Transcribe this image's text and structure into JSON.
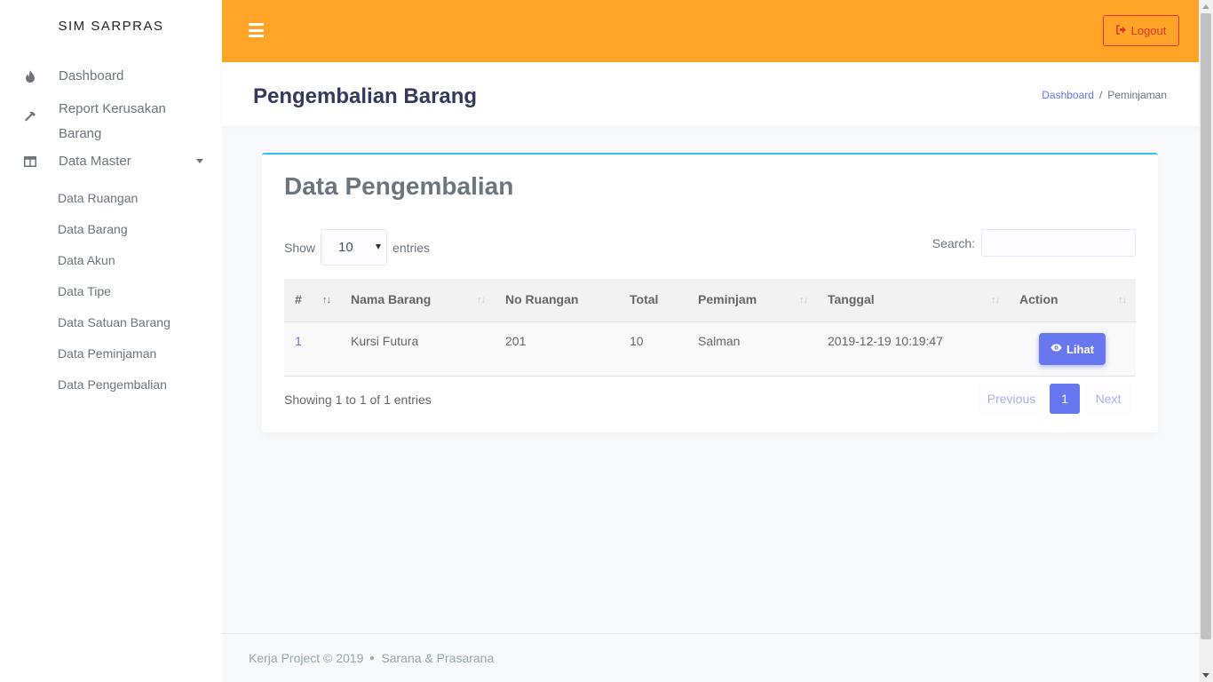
{
  "sidebar": {
    "brand": "SIM SARPRAS",
    "items": [
      {
        "label": "Dashboard",
        "icon": "fire-icon"
      },
      {
        "label": "Report Kerusakan Barang",
        "icon": "hammer-icon"
      },
      {
        "label": "Data Master",
        "icon": "columns-icon"
      }
    ],
    "submenu": [
      {
        "label": "Data Ruangan"
      },
      {
        "label": "Data Barang"
      },
      {
        "label": "Data Akun"
      },
      {
        "label": "Data Tipe"
      },
      {
        "label": "Data Satuan Barang"
      },
      {
        "label": "Data Peminjaman"
      },
      {
        "label": "Data Pengembalian"
      }
    ]
  },
  "topbar": {
    "menu_icon": "bars-icon",
    "logout_label": "Logout",
    "logout_icon": "sign-out-icon"
  },
  "header": {
    "title": "Pengembalian Barang",
    "breadcrumb": [
      "Dashboard",
      "/",
      "Peminjaman"
    ]
  },
  "card": {
    "title": "Data Pengembalian",
    "show_label": "Show",
    "length_value": "10",
    "entries_label": "entries",
    "search_label": "Search:",
    "search_value": "",
    "columns": [
      "#",
      "Nama Barang",
      "No Ruangan",
      "Total",
      "Peminjam",
      "Tanggal",
      "Action"
    ],
    "sort_glyph": "↑↓",
    "rows": [
      {
        "no": "1",
        "nama_barang": "Kursi Futura",
        "no_ruangan": "201",
        "total": "10",
        "peminjam": "Salman",
        "tanggal": "2019-12-19 10:19:47",
        "action_label": "Lihat",
        "action_icon": "eye-icon"
      }
    ],
    "info": "Showing 1 to 1 of 1 entries",
    "pagination": {
      "previous": "Previous",
      "current": "1",
      "next": "Next"
    }
  },
  "footer": {
    "left": "Kerja Project © 2019",
    "right": "Sarana & Prasarana"
  },
  "colors": {
    "topbar": "#ffa426",
    "primary": "#6777ef",
    "danger": "#e3342f",
    "card_accent": "#3abaf4"
  }
}
